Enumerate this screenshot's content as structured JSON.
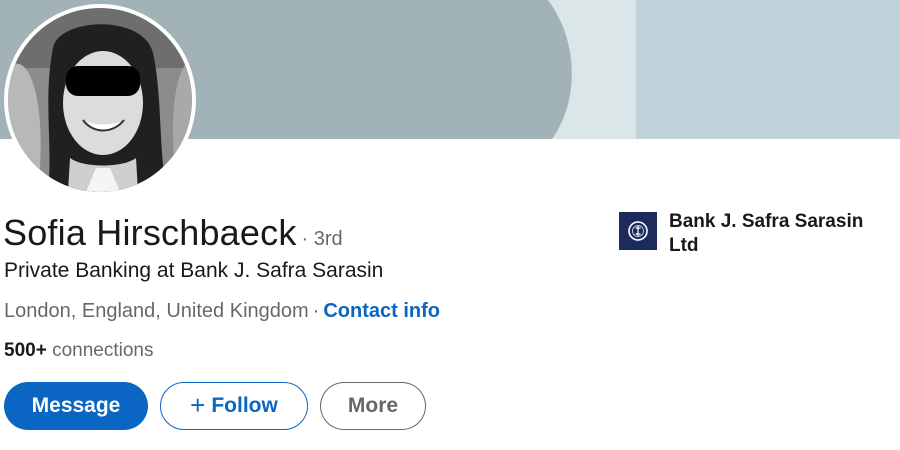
{
  "profile": {
    "name": "Sofia Hirschbaeck",
    "degree": "· 3rd",
    "headline": "Private Banking at Bank J. Safra Sarasin",
    "location": "London, England, United Kingdom",
    "separator": "·",
    "contact_label": "Contact info",
    "connections_count": "500+",
    "connections_label": "connections"
  },
  "actions": {
    "message_label": "Message",
    "follow_plus": "+",
    "follow_label": "Follow",
    "more_label": "More"
  },
  "company": {
    "name": "Bank J. Safra Sarasin Ltd",
    "logo_icon": "bank-safra-sarasin-logo-icon"
  },
  "colors": {
    "accent": "#0a66c2",
    "banner_dark": "#a2b3b8",
    "banner_light": "#c0d3da",
    "company_logo_bg": "#1d2a5c"
  }
}
